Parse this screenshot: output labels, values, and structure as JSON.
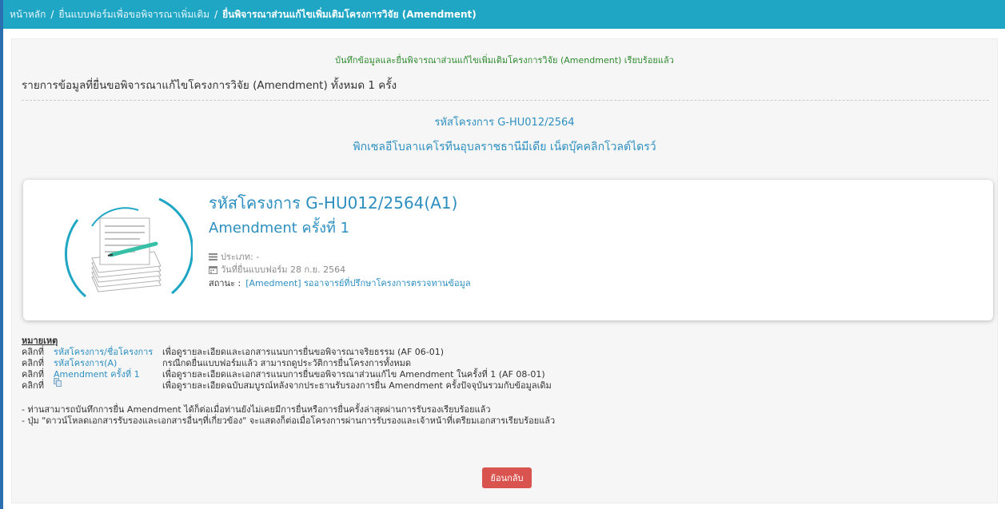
{
  "breadcrumb": {
    "home": "หน้าหลัก",
    "separator": "/",
    "level2": "ยื่นแบบฟอร์มเพื่อขอพิจารณาเพิ่มเติม",
    "current": "ยื่นพิจารณาส่วนแก้ไขเพิ่มเติมโครงการวิจัย (Amendment)"
  },
  "success_message": "บันทึกข้อมูลและยื่นพิจารณาส่วนแก้ไขเพิ่มเติมโครงการวิจัย (Amendment) เรียบร้อยแล้ว",
  "list_heading": "รายการข้อมูลที่ยื่นขอพิจารณาแก้ไขโครงการวิจัย (Amendment) ทั้งหมด 1 ครั้ง",
  "project": {
    "code_line": "รหัสโครงการ G-HU012/2564",
    "name": "พิกเซลอีโบลาแคโรทีนอุบลราชธานีมีเดีย เน็ตบุ๊คคลิกโวลต์ไดรว์"
  },
  "card": {
    "title": "รหัสโครงการ G-HU012/2564(A1)",
    "subtitle": "Amendment ครั้งที่ 1",
    "type_line": "ประเภท: -",
    "date_line": "วันที่ยื่นแบบฟอร์ม 28 ก.ย. 2564",
    "status_label": "สถานะ :",
    "status_value": "[Amedment] รออาจารย์ที่ปรึกษาโครงการตรวจทานข้อมูล"
  },
  "notes": {
    "title": "หมายเหตุ",
    "click_prefix": "คลิกที่",
    "rows": [
      {
        "link": "รหัสโครงการ/ชื่อโครงการ",
        "desc": "เพื่อดูรายละเอียดและเอกสารแนบการยื่นขอพิจารณาจริยธรรม (AF 06-01)"
      },
      {
        "link": "รหัสโครงการ(A)",
        "desc": "กรณีกดยื่นแบบฟอร์มแล้ว สามารถดูประวัติการยื่นโครงการทั้งหมด"
      },
      {
        "link": "Amendment ครั้งที่ 1",
        "desc": "เพื่อดูรายละเอียดและเอกสารแนบการยื่นขอพิจารณาส่วนแก้ไข Amendment ในครั้งที่ 1 (AF 08-01)"
      },
      {
        "link": "",
        "desc": "เพื่อดูรายละเอียดฉบับสมบูรณ์หลังจากประธานรับรองการยื่น Amendment ครั้งปัจจุบันรวมกับข้อมูลเดิม"
      }
    ],
    "bullets": [
      "- ท่านสามารถบันทึกการยื่น Amendment ได้ก็ต่อเมื่อท่านยังไม่เคยมีการยื่นหรือการยื่นครั้งล่าสุดผ่านการรับรองเรียบร้อยแล้ว",
      "- ปุ่ม \"ดาวน์โหลดเอกสารรับรองและเอกสารอื่นๆที่เกี่ยวข้อง\" จะแสดงก็ต่อเมื่อโครงการผ่านการรับรองและเจ้าหน้าที่เตรียมเอกสารเรียบร้อยแล้ว"
    ]
  },
  "back_button": "ย้อนกลับ",
  "colors": {
    "header": "#1ea6c4",
    "link": "#2d8fc0",
    "success": "#2f8a2f",
    "back_button": "#d9534f"
  }
}
